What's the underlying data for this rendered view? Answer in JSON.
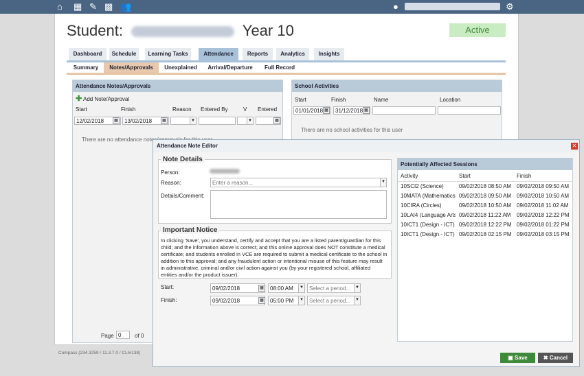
{
  "student": {
    "prefix": "Student:",
    "year": "Year 10",
    "status": "Active"
  },
  "main_tabs": [
    "Dashboard",
    "Schedule",
    "Learning Tasks",
    "Attendance",
    "Reports",
    "Analytics",
    "Insights"
  ],
  "sub_tabs": [
    "Summary",
    "Notes/Approvals",
    "Unexplained",
    "Arrival/Departure",
    "Full Record"
  ],
  "attendance_panel": {
    "title": "Attendance Notes/Approvals",
    "add_label": "Add Note/Approval",
    "columns": [
      "Start",
      "Finish",
      "Reason",
      "Entered By",
      "V",
      "Entered"
    ],
    "start_value": "12/02/2018",
    "finish_value": "13/02/2018",
    "empty_text": "There are no attendance notes/approvals for this user",
    "page_label": "Page",
    "page_value": "0",
    "page_of": "of 0"
  },
  "school_panel": {
    "title": "School Activities",
    "columns": [
      "Start",
      "Finish",
      "Name",
      "Location"
    ],
    "start_value": "01/01/2018",
    "finish_value": "31/12/2018",
    "empty_text": "There are no school activities for this user"
  },
  "editor": {
    "title": "Attendance Note Editor",
    "note_details": "Note Details",
    "person_label": "Person:",
    "reason_label": "Reason:",
    "reason_placeholder": "Enter a reason...",
    "details_label": "Details/Comment:",
    "notice_title": "Important Notice",
    "notice_text": "In clicking 'Save', you understand, certify and accept that you are a listed parent/guardian for this child; and the information above is correct; and this online approval does NOT constitute a medical certificate; and students enrolled in VCE are required to submit a medical certificate to the school in addition to this approval; and any fraudulent action or intentional misuse of this feature may result in administrative, criminal and/or civil action against you (by your registered school, affiliated entities and/or the product issuer).",
    "start_label": "Start:",
    "finish_label": "Finish:",
    "start_date": "09/02/2018",
    "finish_date": "09/02/2018",
    "start_time": "08:00 AM",
    "finish_time": "05:00 PM",
    "period_placeholder": "Select a period...",
    "save_label": "Save",
    "cancel_label": "Cancel"
  },
  "sessions": {
    "title": "Potentially Affected Sessions",
    "columns": [
      "Activity",
      "Start",
      "Finish"
    ],
    "rows": [
      [
        "10SCI2 (Science)",
        "09/02/2018 08:50 AM",
        "09/02/2018 09:50 AM"
      ],
      [
        "10MATA (Mathematics)",
        "09/02/2018 09:50 AM",
        "09/02/2018 10:50 AM"
      ],
      [
        "10CIRA (Circles)",
        "09/02/2018 10:50 AM",
        "09/02/2018 11:02 AM"
      ],
      [
        "10LAI4 (Language Arts)",
        "09/02/2018 11:22 AM",
        "09/02/2018 12:22 PM"
      ],
      [
        "10ICT1 (Design - ICT)",
        "09/02/2018 12:22 PM",
        "09/02/2018 01:22 PM"
      ],
      [
        "10ICT1 (Design - ICT)",
        "09/02/2018 02:15 PM",
        "09/02/2018 03:15 PM"
      ]
    ]
  },
  "footer": {
    "version": "Compass (234.3259 / 11.3.7.0 / CLI#138)"
  }
}
